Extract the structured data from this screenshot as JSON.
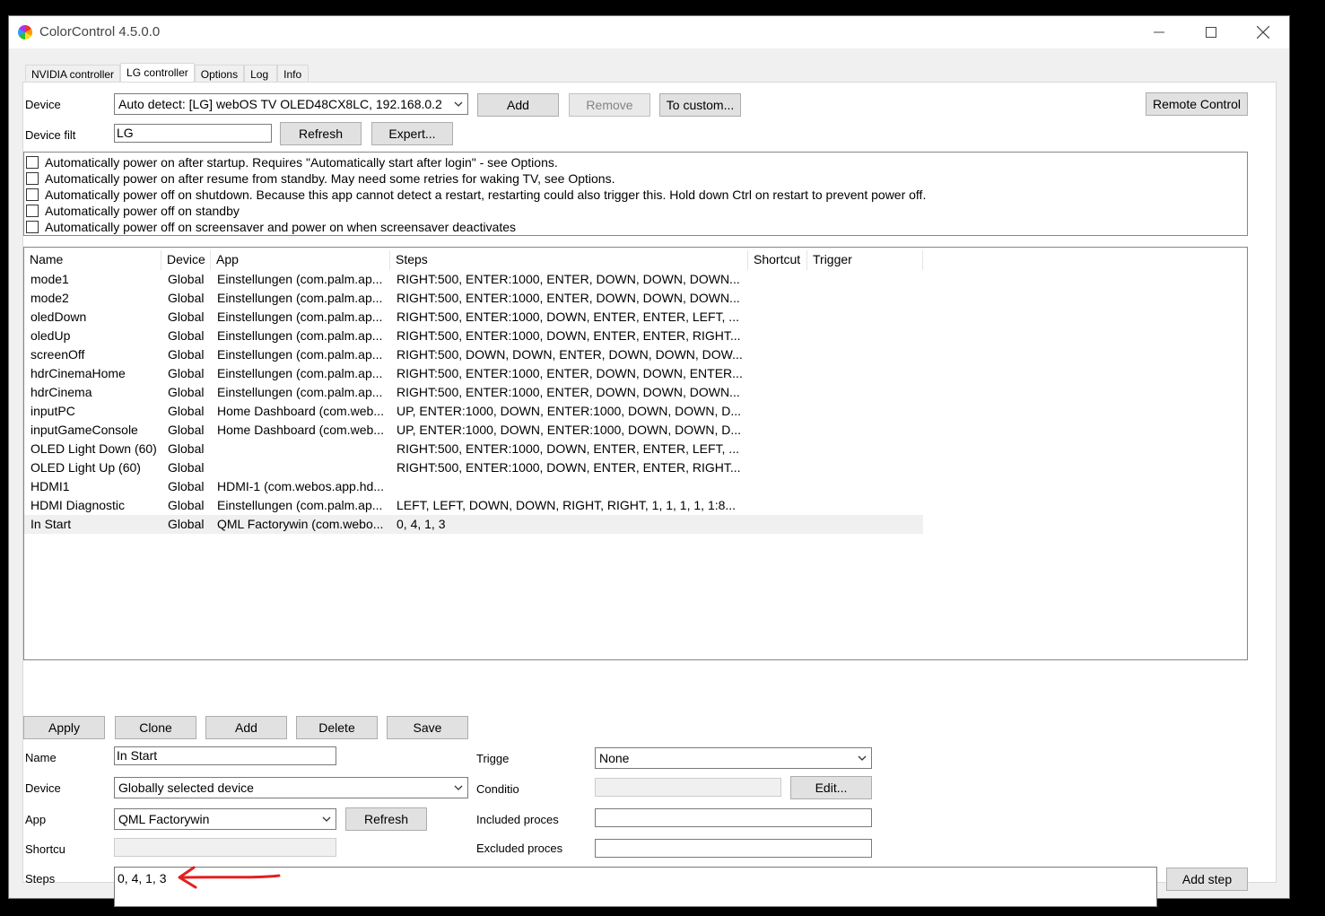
{
  "window": {
    "title": "ColorControl 4.5.0.0",
    "minimize_icon": "minimize-icon",
    "maximize_icon": "maximize-icon",
    "close_icon": "close-icon"
  },
  "tabs": [
    {
      "label": "NVIDIA controller",
      "active": false
    },
    {
      "label": "LG controller",
      "active": true
    },
    {
      "label": "Options",
      "active": false
    },
    {
      "label": "Log",
      "active": false
    },
    {
      "label": "Info",
      "active": false
    }
  ],
  "device_row": {
    "label": "Device",
    "selected": "Auto detect: [LG] webOS TV OLED48CX8LC, 192.168.0.2",
    "add": "Add",
    "remove": "Remove",
    "to_custom": "To custom...",
    "remote_control": "Remote Control"
  },
  "filter_row": {
    "label": "Device filt",
    "value": "LG",
    "refresh": "Refresh",
    "expert": "Expert..."
  },
  "options": [
    {
      "label": "Automatically power on after startup. Requires \"Automatically start after login\" - see Options.",
      "checked": false
    },
    {
      "label": "Automatically power on after resume from standby. May need some retries for waking TV, see Options.",
      "checked": false
    },
    {
      "label": "Automatically power off on shutdown. Because this app cannot detect a restart, restarting could also trigger this. Hold down Ctrl on restart to prevent power off.",
      "checked": false
    },
    {
      "label": "Automatically power off on standby",
      "checked": false
    },
    {
      "label": "Automatically power off on screensaver and power on when screensaver deactivates",
      "checked": false
    }
  ],
  "presets": {
    "columns": [
      "Name",
      "Device",
      "App",
      "Steps",
      "Shortcut",
      "Trigger"
    ],
    "rows": [
      {
        "name": "mode1",
        "device": "Global",
        "app": "Einstellungen (com.palm.ap...",
        "steps": "RIGHT:500, ENTER:1000, ENTER, DOWN, DOWN, DOWN..."
      },
      {
        "name": "mode2",
        "device": "Global",
        "app": "Einstellungen (com.palm.ap...",
        "steps": "RIGHT:500, ENTER:1000, ENTER, DOWN, DOWN, DOWN..."
      },
      {
        "name": "oledDown",
        "device": "Global",
        "app": "Einstellungen (com.palm.ap...",
        "steps": "RIGHT:500, ENTER:1000, DOWN, ENTER, ENTER, LEFT, ..."
      },
      {
        "name": "oledUp",
        "device": "Global",
        "app": "Einstellungen (com.palm.ap...",
        "steps": "RIGHT:500, ENTER:1000, DOWN, ENTER, ENTER, RIGHT..."
      },
      {
        "name": "screenOff",
        "device": "Global",
        "app": "Einstellungen (com.palm.ap...",
        "steps": "RIGHT:500, DOWN, DOWN, ENTER, DOWN, DOWN, DOW..."
      },
      {
        "name": "hdrCinemaHome",
        "device": "Global",
        "app": "Einstellungen (com.palm.ap...",
        "steps": "RIGHT:500, ENTER:1000, ENTER, DOWN, DOWN, ENTER..."
      },
      {
        "name": "hdrCinema",
        "device": "Global",
        "app": "Einstellungen (com.palm.ap...",
        "steps": "RIGHT:500, ENTER:1000, ENTER, DOWN, DOWN, DOWN..."
      },
      {
        "name": "inputPC",
        "device": "Global",
        "app": "Home Dashboard (com.web...",
        "steps": "UP, ENTER:1000, DOWN, ENTER:1000, DOWN, DOWN, D..."
      },
      {
        "name": "inputGameConsole",
        "device": "Global",
        "app": "Home Dashboard (com.web...",
        "steps": "UP, ENTER:1000, DOWN, ENTER:1000, DOWN, DOWN, D..."
      },
      {
        "name": "OLED Light Down (60)",
        "device": "Global",
        "app": "",
        "steps": "RIGHT:500, ENTER:1000, DOWN, ENTER, ENTER, LEFT, ..."
      },
      {
        "name": "OLED Light Up (60)",
        "device": "Global",
        "app": "",
        "steps": "RIGHT:500, ENTER:1000, DOWN, ENTER, ENTER, RIGHT..."
      },
      {
        "name": "HDMI1",
        "device": "Global",
        "app": "HDMI-1 (com.webos.app.hd...",
        "steps": ""
      },
      {
        "name": "HDMI Diagnostic",
        "device": "Global",
        "app": "Einstellungen (com.palm.ap...",
        "steps": "LEFT, LEFT, DOWN, DOWN, RIGHT, RIGHT, 1, 1, 1, 1, 1:8..."
      },
      {
        "name": "In Start",
        "device": "Global",
        "app": "QML Factorywin (com.webo...",
        "steps": "0, 4, 1, 3",
        "selected": true
      }
    ]
  },
  "actions": {
    "apply": "Apply",
    "clone": "Clone",
    "add": "Add",
    "delete": "Delete",
    "save": "Save"
  },
  "editor": {
    "name_label": "Name",
    "name_value": "In Start",
    "device_label": "Device",
    "device_value": "Globally selected device",
    "app_label": "App",
    "app_value": "QML Factorywin",
    "app_refresh": "Refresh",
    "shortcut_label": "Shortcu",
    "shortcut_value": "",
    "steps_label": "Steps",
    "steps_value": "0, 4, 1, 3",
    "add_step": "Add step",
    "trigger_label": "Trigge",
    "trigger_value": "None",
    "condition_label": "Conditio",
    "condition_edit": "Edit...",
    "included_label": "Included proces",
    "included_value": "",
    "excluded_label": "Excluded proces",
    "excluded_value": ""
  },
  "annotation": {
    "color": "#e02020"
  }
}
